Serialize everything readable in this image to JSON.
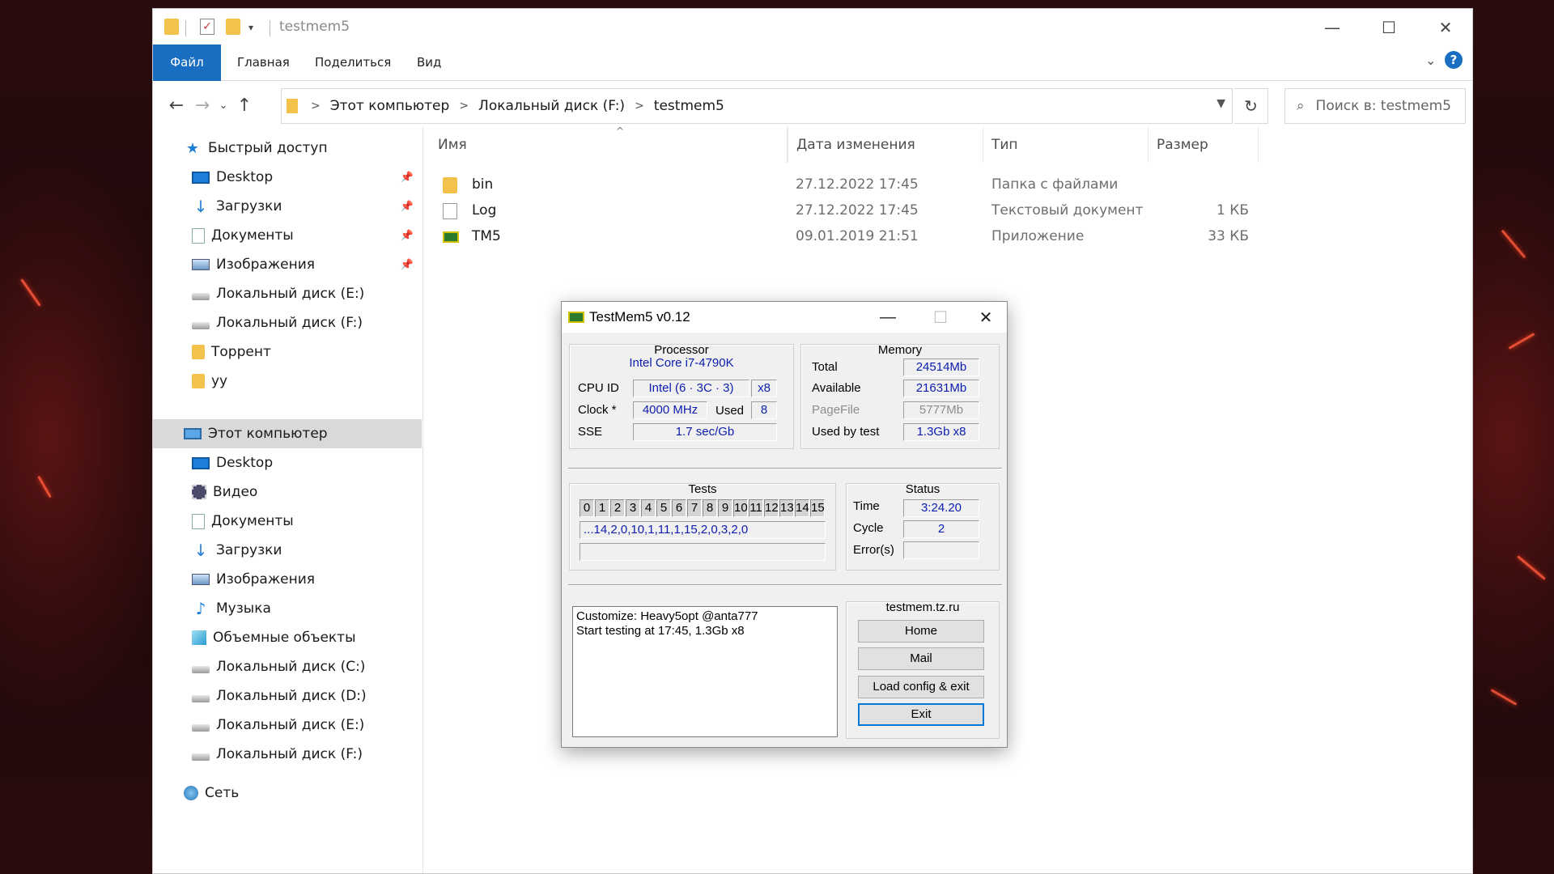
{
  "explorer": {
    "window_title": "testmem5",
    "ribbon": {
      "tabs": [
        "Файл",
        "Главная",
        "Поделиться",
        "Вид"
      ]
    },
    "address": {
      "crumbs": [
        "Этот компьютер",
        "Локальный диск (F:)",
        "testmem5"
      ]
    },
    "search": {
      "placeholder": "Поиск в: testmem5"
    },
    "sidebar": {
      "items": [
        {
          "label": "Быстрый доступ",
          "icon": "star-icon"
        },
        {
          "label": "Desktop",
          "icon": "desktop-icon",
          "pinned": true
        },
        {
          "label": "Загрузки",
          "icon": "download-icon",
          "pinned": true
        },
        {
          "label": "Документы",
          "icon": "documents-icon",
          "pinned": true
        },
        {
          "label": "Изображения",
          "icon": "images-icon",
          "pinned": true
        },
        {
          "label": "Локальный диск (E:)",
          "icon": "drive-icon"
        },
        {
          "label": "Локальный диск (F:)",
          "icon": "drive-icon"
        },
        {
          "label": "Торрент",
          "icon": "folder-icon"
        },
        {
          "label": "уу",
          "icon": "folder-icon"
        },
        {
          "label": "Этот компьютер",
          "icon": "computer-icon",
          "selected": true
        },
        {
          "label": "Desktop",
          "icon": "desktop-icon"
        },
        {
          "label": "Видео",
          "icon": "video-icon"
        },
        {
          "label": "Документы",
          "icon": "documents-icon"
        },
        {
          "label": "Загрузки",
          "icon": "download-icon"
        },
        {
          "label": "Изображения",
          "icon": "images-icon"
        },
        {
          "label": "Музыка",
          "icon": "music-icon"
        },
        {
          "label": "Объемные объекты",
          "icon": "3d-objects-icon"
        },
        {
          "label": "Локальный диск (C:)",
          "icon": "drive-icon"
        },
        {
          "label": "Локальный диск (D:)",
          "icon": "drive-icon"
        },
        {
          "label": "Локальный диск (E:)",
          "icon": "drive-icon"
        },
        {
          "label": "Локальный диск (F:)",
          "icon": "drive-icon"
        },
        {
          "label": "Сеть",
          "icon": "network-icon"
        }
      ]
    },
    "columns": [
      "Имя",
      "Дата изменения",
      "Тип",
      "Размер"
    ],
    "files": [
      {
        "name": "bin",
        "date": "27.12.2022 17:45",
        "type": "Папка с файлами",
        "size": "",
        "icon": "folder-icon"
      },
      {
        "name": "Log",
        "date": "27.12.2022 17:45",
        "type": "Текстовый документ",
        "size": "1 КБ",
        "icon": "text-file-icon"
      },
      {
        "name": "TM5",
        "date": "09.01.2019 21:51",
        "type": "Приложение",
        "size": "33 КБ",
        "icon": "ram-app-icon"
      }
    ]
  },
  "testmem": {
    "title": "TestMem5 v0.12",
    "processor": {
      "heading": "Processor",
      "name": "Intel Core i7-4790K",
      "cpu_id_label": "CPU ID",
      "cpu_id": "Intel  (6 · 3C · 3)",
      "threads": "x8",
      "clock_label": "Clock *",
      "clock": "4000 MHz",
      "used_label": "Used",
      "used": "8",
      "sse_label": "SSE",
      "sse": "1.7 sec/Gb"
    },
    "memory": {
      "heading": "Memory",
      "total_label": "Total",
      "total": "24514Mb",
      "available_label": "Available",
      "available": "21631Mb",
      "pagefile_label": "PageFile",
      "pagefile": "5777Mb",
      "used_by_test_label": "Used by test",
      "used_by_test": "1.3Gb x8"
    },
    "tests": {
      "heading": "Tests",
      "numbers": [
        "0",
        "1",
        "2",
        "3",
        "4",
        "5",
        "6",
        "7",
        "8",
        "9",
        "10",
        "11",
        "12",
        "13",
        "14",
        "15"
      ],
      "sequence": "...14,2,0,10,1,11,1,15,2,0,3,2,0"
    },
    "status": {
      "heading": "Status",
      "time_label": "Time",
      "time": "3:24.20",
      "cycle_label": "Cycle",
      "cycle": "2",
      "errors_label": "Error(s)",
      "errors": ""
    },
    "log_lines": [
      "Customize: Heavy5opt @anta777",
      "Start testing at 17:45, 1.3Gb x8"
    ],
    "site": "testmem.tz.ru",
    "buttons": {
      "home": "Home",
      "mail": "Mail",
      "load": "Load config & exit",
      "exit": "Exit"
    }
  }
}
